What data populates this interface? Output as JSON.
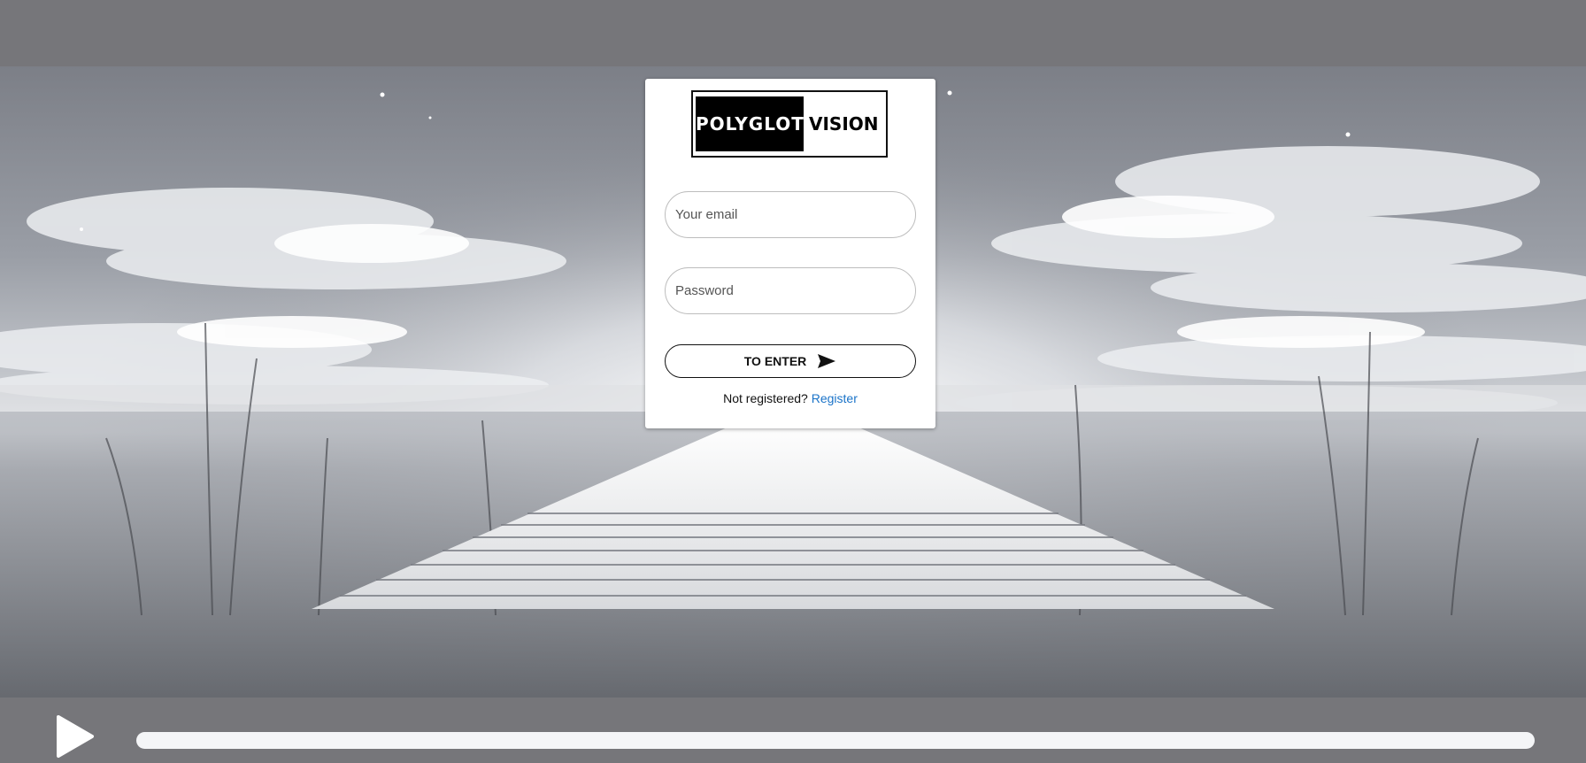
{
  "logo": {
    "word1": "POLYGLOT",
    "word2": "VISION"
  },
  "login": {
    "email_placeholder": "Your email",
    "password_placeholder": "Password",
    "submit_label": "TO ENTER",
    "submit_icon": "send-icon",
    "register_prompt": "Not registered?",
    "register_link": "Register"
  },
  "video": {
    "play_icon": "play-icon",
    "progress_fraction": 0
  },
  "colors": {
    "backdrop": "#76767a",
    "link": "#1a73c8",
    "card": "#ffffff"
  }
}
